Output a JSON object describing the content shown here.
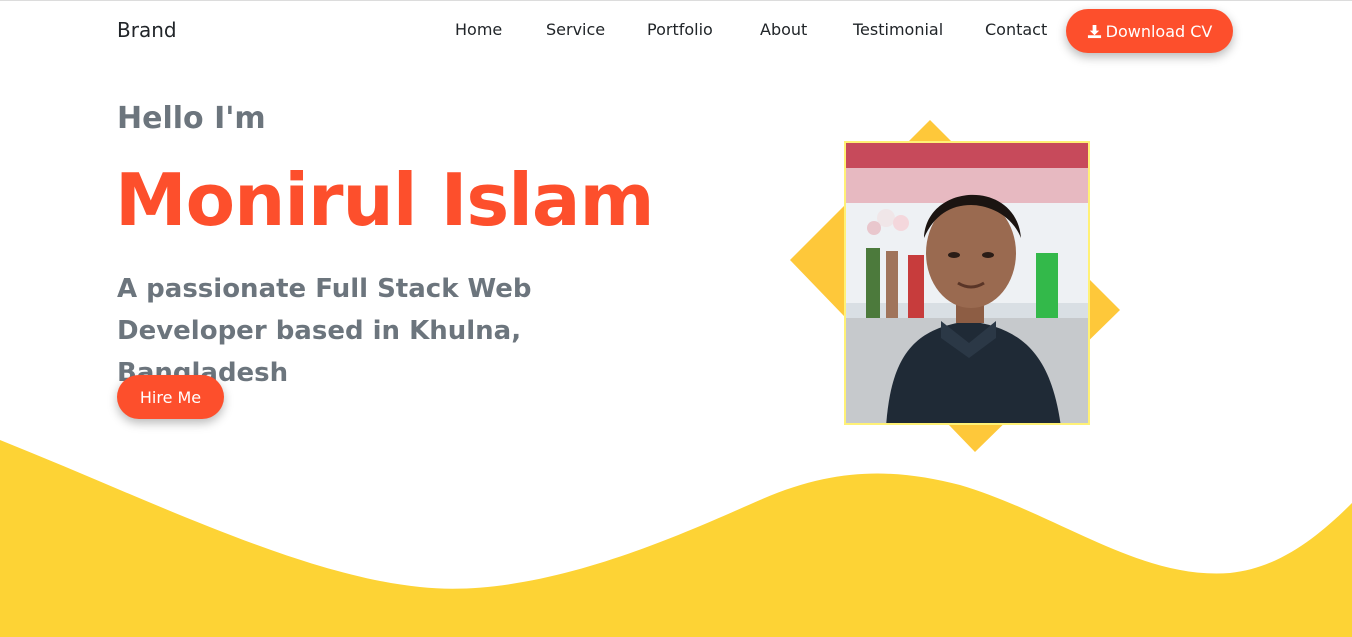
{
  "brand": "Brand",
  "nav": {
    "items": [
      {
        "label": "Home"
      },
      {
        "label": "Service"
      },
      {
        "label": "Portfolio"
      },
      {
        "label": "About"
      },
      {
        "label": "Testimonial"
      },
      {
        "label": "Contact"
      }
    ],
    "download_label": "Download CV",
    "download_icon": "download-icon"
  },
  "hero": {
    "greeting": "Hello I'm",
    "name": "Monirul Islam",
    "tagline": "A passionate Full Stack Web Developer based in Khulna, Bangladesh",
    "hire_label": "Hire Me"
  },
  "colors": {
    "accent": "#fd4f2c",
    "yellow": "#fdd335",
    "text_muted": "#6c757d",
    "text_dark": "#212529"
  }
}
